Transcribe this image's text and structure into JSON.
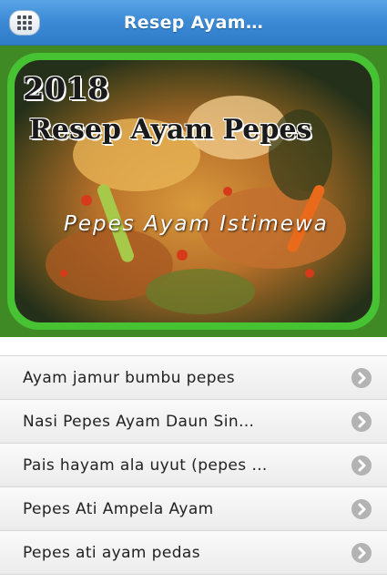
{
  "header": {
    "title": "Resep Ayam…",
    "menu_icon": "grid-menu-icon"
  },
  "hero": {
    "year": "2018",
    "title": "Resep Ayam Pepes",
    "subtitle": "Pepes Ayam Istimewa",
    "frame_color": "#3cba2c"
  },
  "list": {
    "items": [
      {
        "label": "Ayam jamur bumbu pepes",
        "icon": "chevron-right-icon"
      },
      {
        "label": "Nasi Pepes Ayam Daun Sin…",
        "icon": "chevron-right-icon"
      },
      {
        "label": "Pais hayam ala uyut (pepes …",
        "icon": "chevron-right-icon"
      },
      {
        "label": "Pepes Ati Ampela Ayam",
        "icon": "chevron-right-icon"
      },
      {
        "label": "Pepes ati ayam pedas",
        "icon": "chevron-right-icon"
      }
    ]
  }
}
